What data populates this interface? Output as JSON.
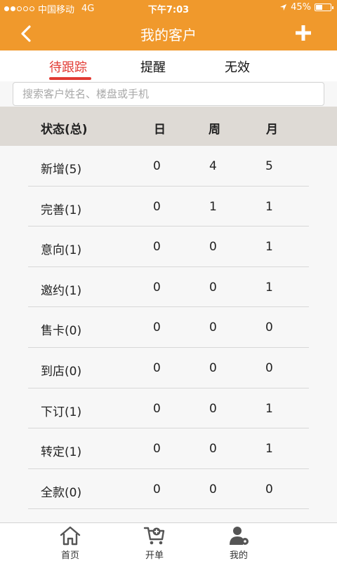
{
  "status_bar": {
    "carrier": "中国移动",
    "network": "4G",
    "time": "下午7:03",
    "battery_text": "45%",
    "battery_level": 0.45,
    "signal_bars_filled": 2,
    "signal_bars_total": 5,
    "location_icon": "location-arrow-icon"
  },
  "nav": {
    "title": "我的客户",
    "back_icon": "chevron-left-icon",
    "add_icon": "plus-icon"
  },
  "tabs": [
    {
      "label": "待跟踪",
      "active": true
    },
    {
      "label": "提醒",
      "active": false
    },
    {
      "label": "无效",
      "active": false
    }
  ],
  "search": {
    "placeholder": "搜索客户姓名、楼盘或手机",
    "value": ""
  },
  "table": {
    "headers": [
      "状态(总)",
      "日",
      "周",
      "月"
    ],
    "rows": [
      [
        "新增(5)",
        "0",
        "4",
        "5"
      ],
      [
        "完善(1)",
        "0",
        "1",
        "1"
      ],
      [
        "意向(1)",
        "0",
        "0",
        "1"
      ],
      [
        "邀约(1)",
        "0",
        "0",
        "1"
      ],
      [
        "售卡(0)",
        "0",
        "0",
        "0"
      ],
      [
        "到店(0)",
        "0",
        "0",
        "0"
      ],
      [
        "下订(1)",
        "0",
        "0",
        "1"
      ],
      [
        "转定(1)",
        "0",
        "0",
        "1"
      ],
      [
        "全款(0)",
        "0",
        "0",
        "0"
      ]
    ]
  },
  "tabbar": [
    {
      "label": "首页",
      "icon": "home-icon"
    },
    {
      "label": "开单",
      "icon": "cart-add-icon"
    },
    {
      "label": "我的",
      "icon": "user-settings-icon"
    }
  ],
  "colors": {
    "accent": "#f0992c",
    "active_tab": "#e23a33",
    "header_bg": "#dedad5"
  }
}
